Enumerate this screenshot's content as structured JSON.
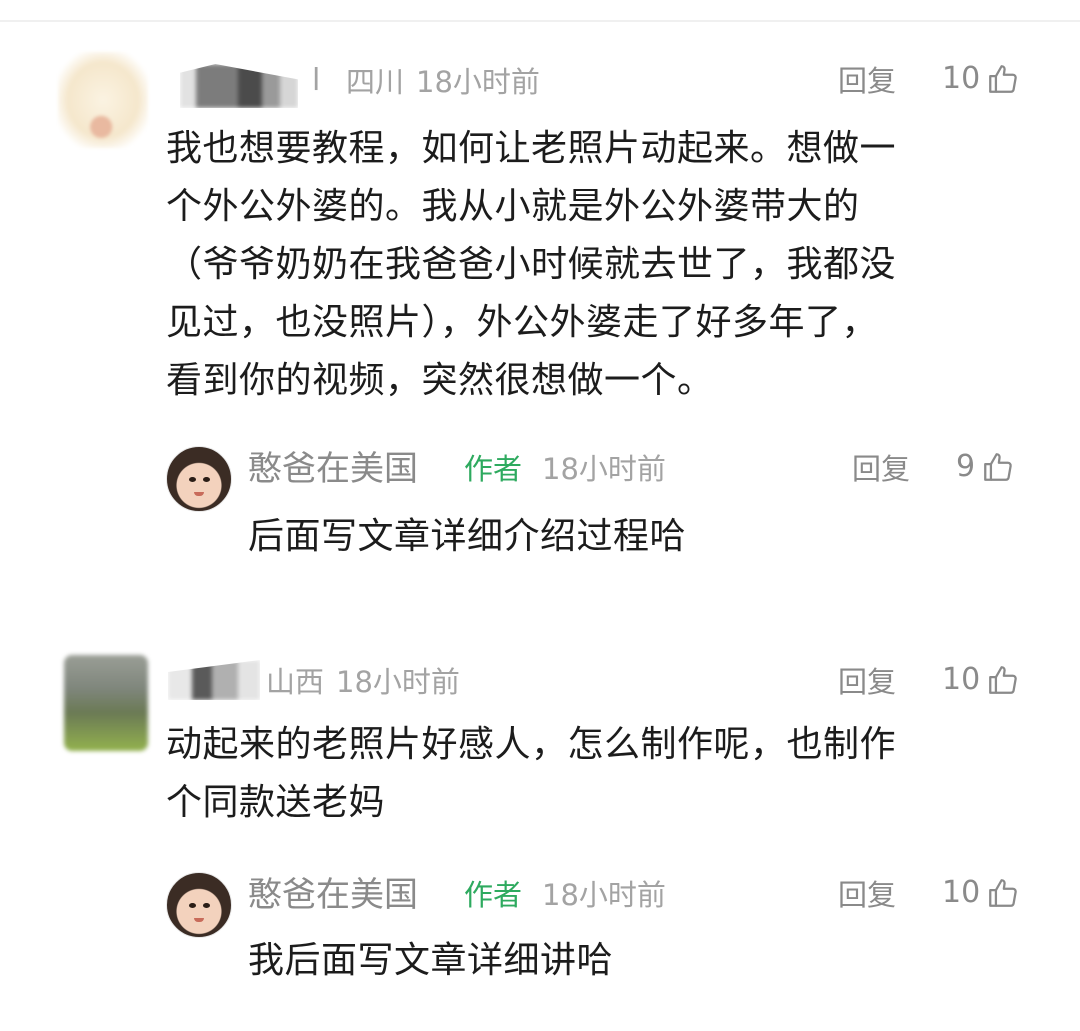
{
  "comments": [
    {
      "location": "四川",
      "time": "18小时前",
      "name_tail": "l",
      "text_lines": [
        "我也想要教程，如何让老照片动起来。想做一",
        "个外公外婆的。我从小就是外公外婆带大的",
        "（爷爷奶奶在我爸爸小时候就去世了，我都没",
        "见过，也没照片），外公外婆走了好多年了，",
        "看到你的视频，突然很想做一个。"
      ],
      "reply_label": "回复",
      "likes": "10",
      "reply": {
        "name": "憨爸在美国",
        "tag": "作者",
        "time": "18小时前",
        "text": "后面写文章详细介绍过程哈",
        "reply_label": "回复",
        "likes": "9"
      }
    },
    {
      "location": "山西",
      "time": "18小时前",
      "text_lines": [
        "动起来的老照片好感人，怎么制作呢，也制作",
        "个同款送老妈"
      ],
      "reply_label": "回复",
      "likes": "10",
      "reply": {
        "name": "憨爸在美国",
        "tag": "作者",
        "time": "18小时前",
        "text": "我后面写文章详细讲哈",
        "reply_label": "回复",
        "likes": "10"
      }
    }
  ],
  "icons": {
    "like": "thumbs-up-outline"
  },
  "colors": {
    "author_tag": "#2eaa5f",
    "meta": "#a3a3a3",
    "text": "#1c1c1c"
  }
}
